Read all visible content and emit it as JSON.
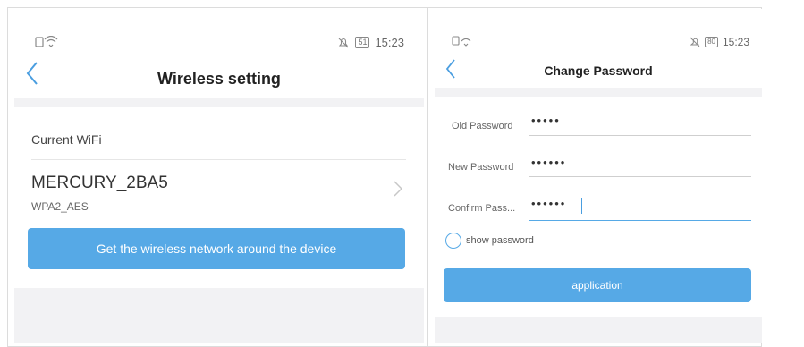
{
  "left": {
    "status": {
      "time": "15:23",
      "battery": "51"
    },
    "header": {
      "title": "Wireless setting",
      "back_icon": "chevron-left-icon"
    },
    "current_wifi_label": "Current WiFi",
    "network": {
      "ssid": "MERCURY_2BA5",
      "security": "WPA2_AES"
    },
    "scan_button": "Get the wireless network around the device"
  },
  "right": {
    "status": {
      "time": "15:23",
      "battery": "80"
    },
    "header": {
      "title": "Change Password",
      "back_icon": "chevron-left-icon"
    },
    "fields": [
      {
        "label": "Old Password",
        "value": "•••••"
      },
      {
        "label": "New Password",
        "value": "••••••"
      },
      {
        "label": "Confirm Pass...",
        "value": "••••••"
      }
    ],
    "show_password": "show password",
    "submit_button": "application"
  },
  "colors": {
    "accent": "#56a9e6",
    "back": "#4a9ee0",
    "gray_bg": "#f2f2f4"
  }
}
